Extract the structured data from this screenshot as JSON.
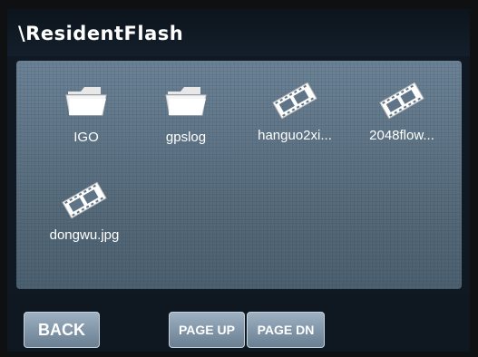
{
  "window": {
    "path": "\\ResidentFlash"
  },
  "files": [
    {
      "name": "IGO",
      "type": "folder",
      "icon": "folder-icon"
    },
    {
      "name": "gpslog",
      "type": "folder",
      "icon": "folder-icon"
    },
    {
      "name": "hanguo2xi...",
      "type": "image",
      "icon": "film-icon"
    },
    {
      "name": "2048flow...",
      "type": "image",
      "icon": "film-icon"
    },
    {
      "name": "dongwu.jpg",
      "type": "image",
      "icon": "film-icon"
    }
  ],
  "buttons": {
    "back": "BACK",
    "page_up": "PAGE UP",
    "page_dn": "PAGE DN"
  },
  "colors": {
    "panel": "#5f7587",
    "button": "#8a9fb2",
    "title_bg": "#101922"
  }
}
